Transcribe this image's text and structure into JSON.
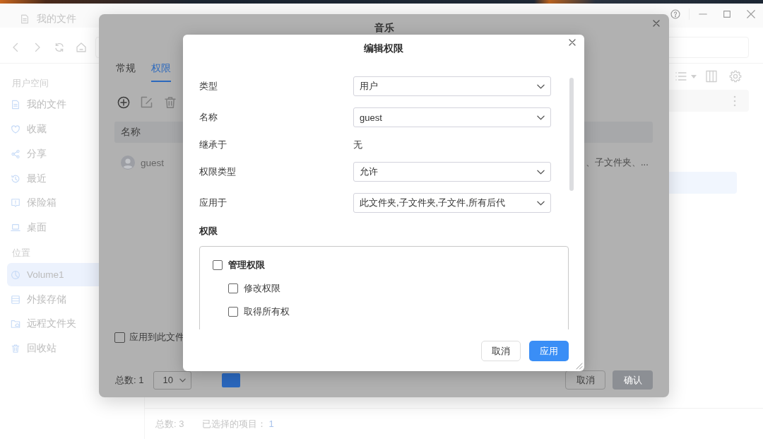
{
  "window": {
    "title": "我的文件"
  },
  "sidebar": {
    "sections": [
      {
        "title": "用户空间",
        "items": [
          {
            "label": "我的文件",
            "selected": false
          },
          {
            "label": "收藏",
            "selected": false
          },
          {
            "label": "分享",
            "selected": false
          },
          {
            "label": "最近",
            "selected": false
          },
          {
            "label": "保险箱",
            "selected": false
          },
          {
            "label": "桌面",
            "selected": false
          }
        ]
      },
      {
        "title": "位置",
        "items": [
          {
            "label": "Volume1",
            "selected": true
          },
          {
            "label": "外接存储",
            "selected": false
          },
          {
            "label": "远程文件夹",
            "selected": false
          },
          {
            "label": "回收站",
            "selected": false
          }
        ]
      }
    ]
  },
  "file_list": {
    "rows": [
      {
        "selected": true
      }
    ]
  },
  "status_bar": {
    "total": "总数: 3",
    "selected_label": "已选择的项目：",
    "selected_count": "1"
  },
  "properties_dialog": {
    "title": "音乐",
    "tabs": [
      {
        "label": "常规",
        "selected": false
      },
      {
        "label": "权限",
        "selected": true
      }
    ],
    "toolbar": [
      {
        "kind": "add",
        "disabled": false
      },
      {
        "kind": "edit",
        "disabled": true
      },
      {
        "kind": "delete",
        "disabled": true
      }
    ],
    "table": {
      "columns": [
        "名称"
      ],
      "rows": [
        {
          "name": "guest",
          "column_2": "、子文件夹、..."
        }
      ]
    },
    "apply_checkbox": {
      "label": "应用到此文件",
      "checked": false
    },
    "pagination": {
      "total": "总数: 1",
      "page_size": "10",
      "pages": [
        {
          "selected": true
        }
      ]
    },
    "buttons": [
      {
        "label": "取消",
        "kind": "secondary",
        "disabled": false
      },
      {
        "label": "确认",
        "kind": "primary",
        "disabled": true
      }
    ]
  },
  "edit_dialog": {
    "title": "编辑权限",
    "fields": [
      {
        "label": "类型",
        "kind": "select",
        "value": "用户"
      },
      {
        "label": "名称",
        "kind": "select",
        "value": "guest"
      },
      {
        "label": "继承于",
        "kind": "text",
        "value": "无"
      },
      {
        "label": "权限类型",
        "kind": "select",
        "value": "允许"
      },
      {
        "label": "应用于",
        "kind": "select",
        "value": "此文件夹,子文件夹,子文件,所有后代"
      }
    ],
    "permissions_title": "权限",
    "permissions": [
      {
        "label": "管理权限",
        "checked": false,
        "children": [
          {
            "label": "修改权限",
            "checked": false
          },
          {
            "label": "取得所有权",
            "checked": false
          }
        ]
      }
    ],
    "buttons": [
      {
        "label": "取消",
        "kind": "secondary"
      },
      {
        "label": "应用",
        "kind": "primary"
      }
    ]
  }
}
